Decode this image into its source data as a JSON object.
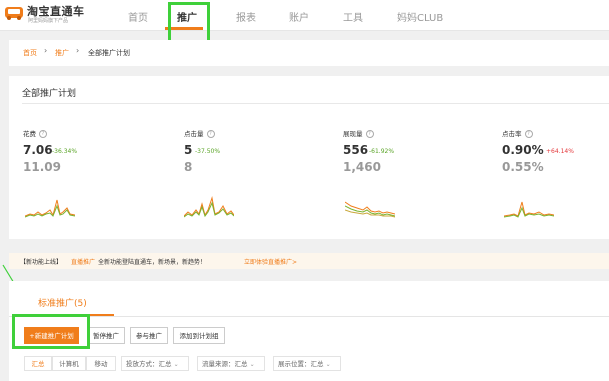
{
  "logo": {
    "title": "淘宝直通车",
    "subtitle": "阿里妈妈旗下产品",
    "icon": "car-logo-icon"
  },
  "nav": {
    "items": [
      "首页",
      "推广",
      "报表",
      "账户",
      "工具",
      "妈妈CLUB"
    ],
    "active": "推广"
  },
  "breadcrumb": {
    "home": "首页",
    "promo": "推广",
    "current": "全部推广计划"
  },
  "panel": {
    "title": "全部推广计划"
  },
  "metrics": [
    {
      "label": "花费",
      "value": "7.06",
      "change": "-36.34%",
      "change_dir": "down",
      "compare": "11.09"
    },
    {
      "label": "点击量",
      "value": "5",
      "change": "-37.50%",
      "change_dir": "down",
      "compare": "8"
    },
    {
      "label": "展现量",
      "value": "556",
      "change": "-61.92%",
      "change_dir": "down",
      "compare": "1,460"
    },
    {
      "label": "点击率",
      "value": "0.90%",
      "change": "+64.14%",
      "change_dir": "up",
      "compare": "0.55%"
    }
  ],
  "banner": {
    "prefix": "【新功能上线】",
    "link1": "直播推广",
    "text": "全新功能登陆直通车，新场景，新趋势！",
    "link2": "立即体验直播推广>"
  },
  "tabs": {
    "standard": "标准推广(5)"
  },
  "buttons": {
    "new_plan": "+新建推广计划",
    "pause": "暂停推广",
    "join": "参与推广",
    "add_group": "添加到计划组"
  },
  "segments": [
    "汇总",
    "计算机",
    "移动"
  ],
  "filters": {
    "delivery": "投放方式：汇总",
    "traffic": "流量来源：汇总",
    "position": "展示位置：汇总"
  },
  "colors": {
    "accent": "#f07d1b",
    "highlight": "#3fd03a",
    "up": "#e4393c",
    "down": "#5aa427"
  }
}
